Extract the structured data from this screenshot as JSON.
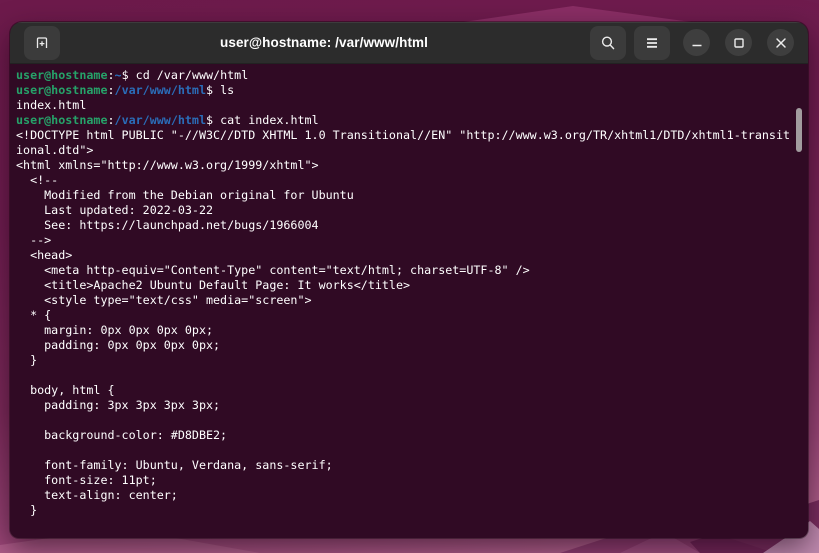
{
  "window": {
    "title": "user@hostname: /var/www/html",
    "icons": {
      "new_tab": "tab-plus",
      "search": "magnifier",
      "menu": "hamburger",
      "minimize": "dash",
      "maximize": "square-outline",
      "close": "cross"
    }
  },
  "terminal": {
    "columns": 110,
    "colors": {
      "background": "#300a24",
      "foreground": "#ffffff",
      "prompt_user": "#26a269",
      "prompt_path": "#2a6db9"
    },
    "lines": [
      [
        {
          "t": "user@hostname",
          "c": "user"
        },
        {
          "t": ":",
          "c": "fg"
        },
        {
          "t": "~",
          "c": "path"
        },
        {
          "t": "$ cd /var/www/html",
          "c": "fg"
        }
      ],
      [
        {
          "t": "user@hostname",
          "c": "user"
        },
        {
          "t": ":",
          "c": "fg"
        },
        {
          "t": "/var/www/html",
          "c": "path"
        },
        {
          "t": "$ ls",
          "c": "fg"
        }
      ],
      [
        {
          "t": "index.html",
          "c": "fg"
        }
      ],
      [
        {
          "t": "user@hostname",
          "c": "user"
        },
        {
          "t": ":",
          "c": "fg"
        },
        {
          "t": "/var/www/html",
          "c": "path"
        },
        {
          "t": "$ cat index.html",
          "c": "fg"
        }
      ],
      [
        {
          "t": "<!DOCTYPE html PUBLIC \"-//W3C//DTD XHTML 1.0 Transitional//EN\" \"http://www.w3.org/TR/xhtml1/DTD/xhtml1-transit",
          "c": "fg"
        }
      ],
      [
        {
          "t": "ional.dtd\">",
          "c": "fg"
        }
      ],
      [
        {
          "t": "<html xmlns=\"http://www.w3.org/1999/xhtml\">",
          "c": "fg"
        }
      ],
      [
        {
          "t": "  <!--",
          "c": "fg"
        }
      ],
      [
        {
          "t": "    Modified from the Debian original for Ubuntu",
          "c": "fg"
        }
      ],
      [
        {
          "t": "    Last updated: 2022-03-22",
          "c": "fg"
        }
      ],
      [
        {
          "t": "    See: https://launchpad.net/bugs/1966004",
          "c": "fg"
        }
      ],
      [
        {
          "t": "  -->",
          "c": "fg"
        }
      ],
      [
        {
          "t": "  <head>",
          "c": "fg"
        }
      ],
      [
        {
          "t": "    <meta http-equiv=\"Content-Type\" content=\"text/html; charset=UTF-8\" />",
          "c": "fg"
        }
      ],
      [
        {
          "t": "    <title>Apache2 Ubuntu Default Page: It works</title>",
          "c": "fg"
        }
      ],
      [
        {
          "t": "    <style type=\"text/css\" media=\"screen\">",
          "c": "fg"
        }
      ],
      [
        {
          "t": "  * {",
          "c": "fg"
        }
      ],
      [
        {
          "t": "    margin: 0px 0px 0px 0px;",
          "c": "fg"
        }
      ],
      [
        {
          "t": "    padding: 0px 0px 0px 0px;",
          "c": "fg"
        }
      ],
      [
        {
          "t": "  }",
          "c": "fg"
        }
      ],
      [],
      [
        {
          "t": "  body, html {",
          "c": "fg"
        }
      ],
      [
        {
          "t": "    padding: 3px 3px 3px 3px;",
          "c": "fg"
        }
      ],
      [],
      [
        {
          "t": "    background-color: #D8DBE2;",
          "c": "fg"
        }
      ],
      [],
      [
        {
          "t": "    font-family: Ubuntu, Verdana, sans-serif;",
          "c": "fg"
        }
      ],
      [
        {
          "t": "    font-size: 11pt;",
          "c": "fg"
        }
      ],
      [
        {
          "t": "    text-align: center;",
          "c": "fg"
        }
      ],
      [
        {
          "t": "  }",
          "c": "fg"
        }
      ]
    ]
  }
}
